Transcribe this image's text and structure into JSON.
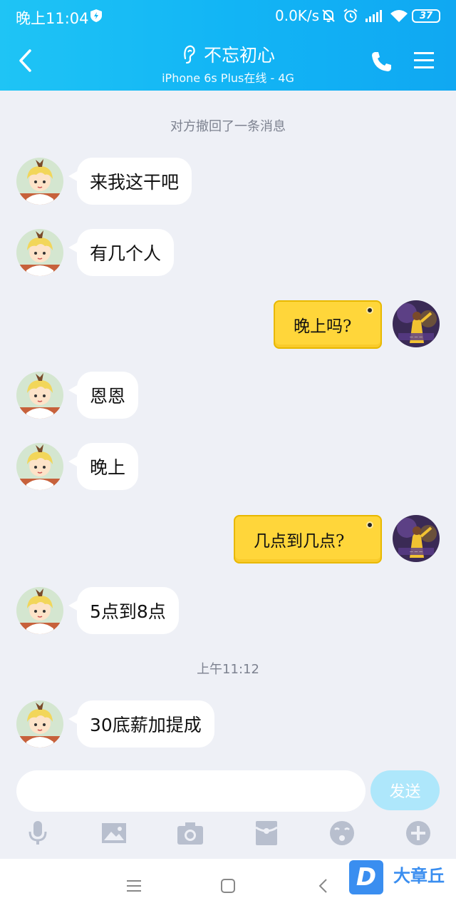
{
  "status_bar": {
    "time": "晚上11:04",
    "network_speed": "0.0K/s",
    "battery": "37"
  },
  "header": {
    "title": "不忘初心",
    "subtitle": "iPhone 6s Plus在线 - 4G"
  },
  "chat": {
    "recall_notice": "对方撤回了一条消息",
    "timestamp": "上午11:12",
    "messages": [
      {
        "side": "left",
        "text": "来我这干吧"
      },
      {
        "side": "left",
        "text": "有几个人"
      },
      {
        "side": "right",
        "text": "晚上吗?"
      },
      {
        "side": "left",
        "text": "恩恩"
      },
      {
        "side": "left",
        "text": "晚上"
      },
      {
        "side": "right",
        "text": "几点到几点?"
      },
      {
        "side": "left",
        "text": "5点到8点"
      },
      {
        "side": "left",
        "text": "30底薪加提成"
      }
    ]
  },
  "input": {
    "placeholder": "",
    "send_label": "发送"
  },
  "toolbar": {
    "icons": [
      "microphone-icon",
      "image-icon",
      "camera-icon",
      "red-packet-icon",
      "emoji-icon",
      "plus-icon"
    ]
  },
  "watermark": {
    "logo_letter": "D",
    "text": "大章丘"
  },
  "colors": {
    "header": "#12b5f5",
    "background": "#eef0f6",
    "sticky_note": "#ffd63a",
    "send_button": "#aee7fb"
  }
}
